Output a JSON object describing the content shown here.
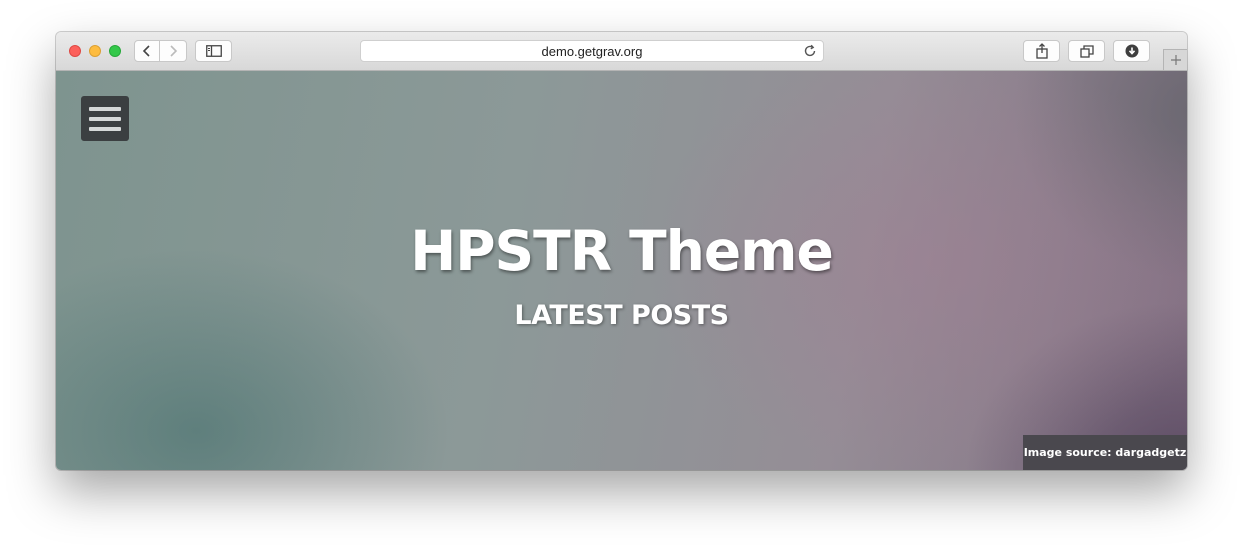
{
  "browser": {
    "url": "demo.getgrav.org"
  },
  "hero": {
    "title": "HPSTR Theme",
    "subtitle": "LATEST POSTS",
    "image_credit": "Image source: dargadgetz"
  },
  "icons": {
    "back": "chevron-left-icon",
    "forward": "chevron-right-icon",
    "sidebar": "sidebar-icon",
    "reload": "reload-icon",
    "share": "share-icon",
    "tabs": "tabs-overview-icon",
    "download": "download-icon",
    "new_tab": "plus-icon",
    "menu": "hamburger-menu-icon"
  },
  "colors": {
    "close_light": "#fc605b",
    "minimize_light": "#fdbc40",
    "zoom_light": "#34c84a",
    "menu_button": "#3b3f41",
    "credit_background": "#4a484e"
  }
}
